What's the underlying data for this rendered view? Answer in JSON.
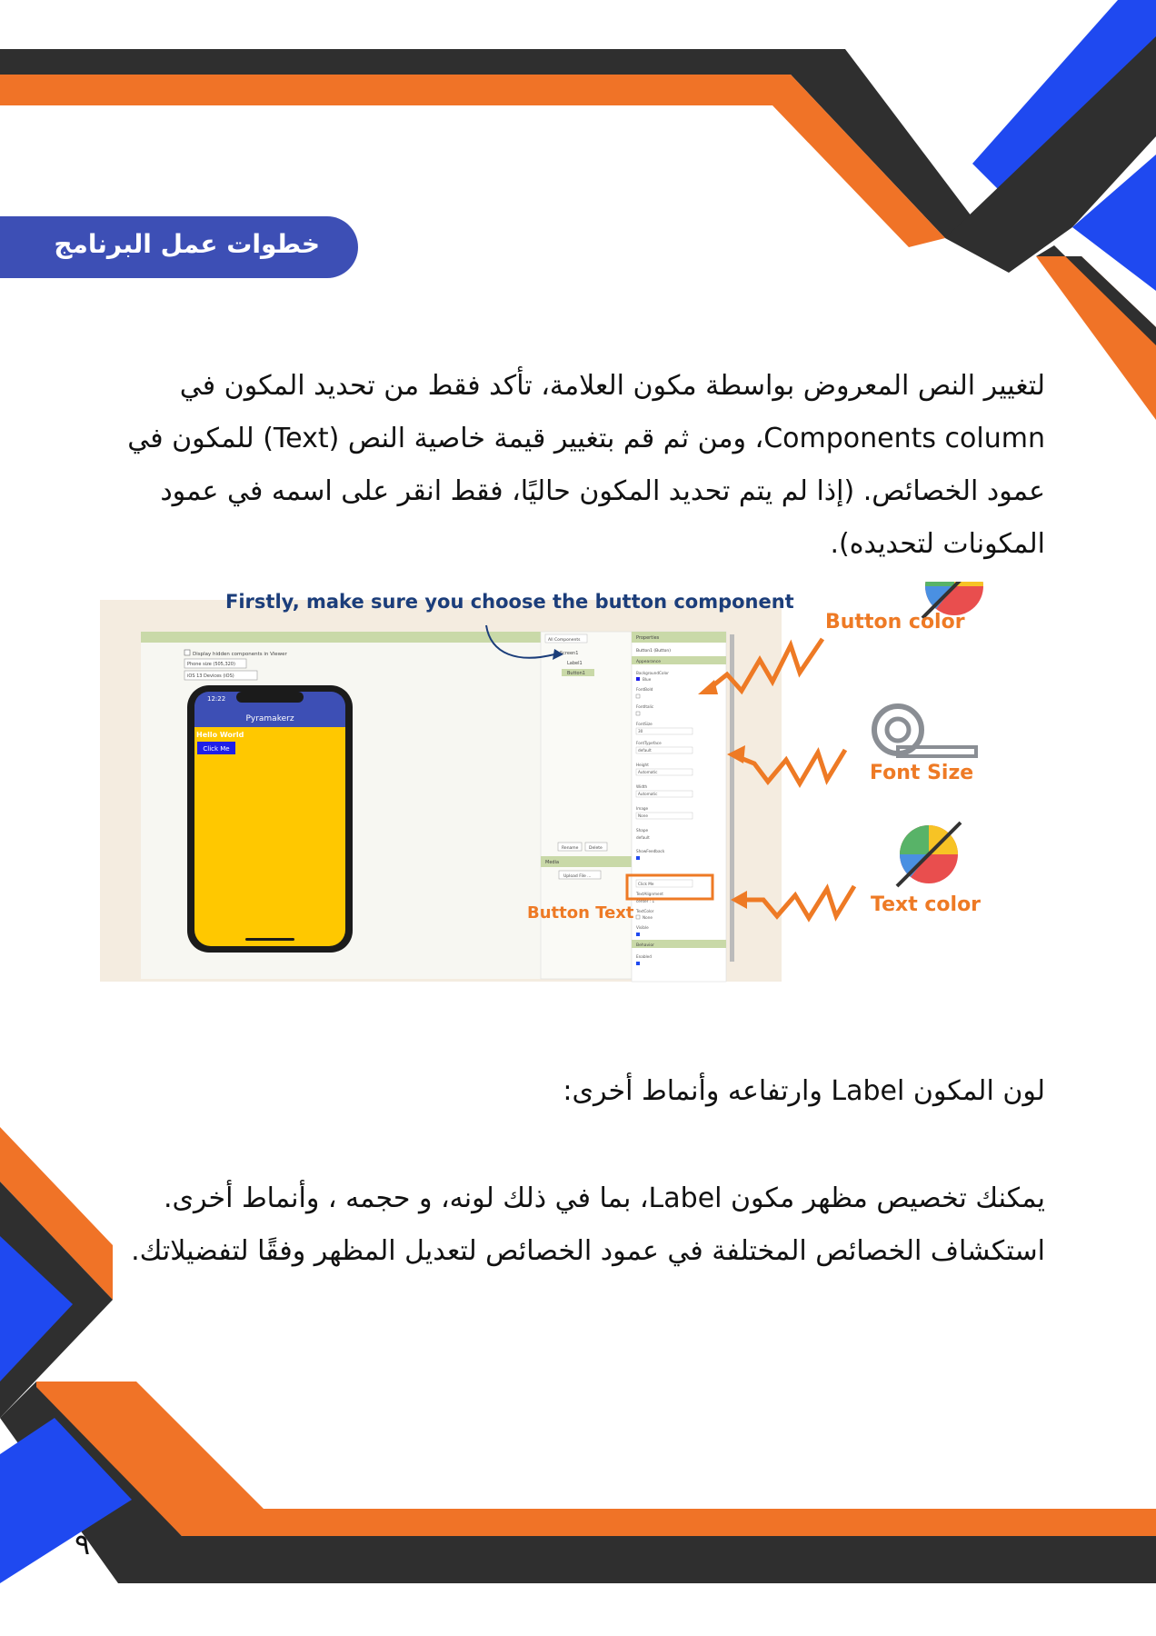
{
  "section": {
    "title": "خطوات عمل البرنامج"
  },
  "paragraphs": [
    {
      "text": "لتغيير النص المعروض بواسطة مكون العلامة، تأكد فقط من تحديد المكون في Components column، ومن ثم قم بتغيير قيمة خاصية النص (Text) للمكون في عمود الخصائص. (إذا لم يتم تحديد المكون حاليًا، فقط انقر على اسمه في عمود المكونات لتحديده)."
    },
    {
      "text": "لون المكون Label وارتفاعه وأنماط أخرى:"
    },
    {
      "text": "يمكنك تخصيص مظهر مكون Label، بما في ذلك لونه، و حجمه ، وأنماط أخرى. استكشاف الخصائص المختلفة في عمود الخصائص لتعديل المظهر وفقًا لتفضيلاتك."
    }
  ],
  "figure": {
    "caption": "Firstly, make sure you choose the button component",
    "labels": {
      "button_color": "Button color",
      "font_size": "Font Size",
      "text_color": "Text color",
      "button_text": "Button Text"
    },
    "viewer": {
      "checkbox_label": "Display hidden components in Viewer",
      "phone_size": "Phone size (505,320)",
      "device": "iOS 13 Devices (iOS)",
      "time": "12:22",
      "app_title": "Pyramakerz",
      "label_text": "Hello World",
      "button_text": "Click Me"
    },
    "components": {
      "header": "All Components",
      "items": [
        "Screen1",
        "Label1",
        "Button1"
      ],
      "rename": "Rename",
      "delete": "Delete",
      "media": "Media",
      "upload": "Upload File ..."
    },
    "properties": {
      "header": "Properties",
      "selected": "Button1 (Button)",
      "appearance": "Appearance",
      "behavior": "Behavior",
      "items": [
        "BackgroundColor",
        "Blue",
        "FontBold",
        "FontItalic",
        "FontSize",
        "30",
        "FontTypeface",
        "default",
        "Height",
        "Automatic",
        "Width",
        "Automatic",
        "Image",
        "None",
        "Shape",
        "default",
        "ShowFeedback",
        "Click Me",
        "TextAlignment",
        "center : 1",
        "TextColor",
        "None",
        "Visible",
        "Enabled"
      ]
    }
  },
  "page_number": "٩",
  "colors": {
    "orange": "#f07327",
    "dark": "#2f2f2f",
    "blue": "#1f49f0",
    "pill": "#3d4fb5",
    "caption": "#1b3d7a",
    "label": "#ee7a25"
  }
}
